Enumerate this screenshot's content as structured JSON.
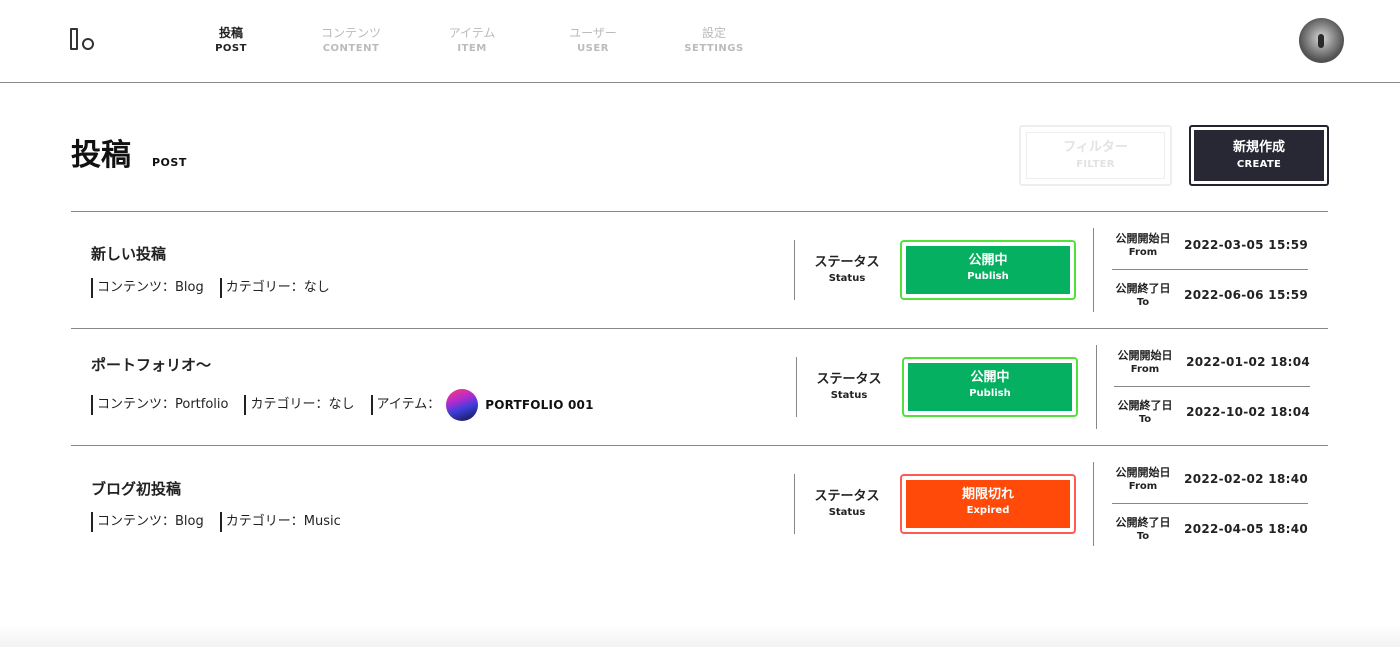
{
  "nav": [
    {
      "jp": "投稿",
      "en": "POST",
      "active": true
    },
    {
      "jp": "コンテンツ",
      "en": "CONTENT",
      "active": false
    },
    {
      "jp": "アイテム",
      "en": "ITEM",
      "active": false
    },
    {
      "jp": "ユーザー",
      "en": "USER",
      "active": false
    },
    {
      "jp": "設定",
      "en": "SETTINGS",
      "active": false
    }
  ],
  "page": {
    "title": "投稿",
    "subtitle": "POST"
  },
  "buttons": {
    "filter": {
      "jp": "フィルター",
      "en": "FILTER"
    },
    "create": {
      "jp": "新規作成",
      "en": "CREATE"
    }
  },
  "status_label": {
    "jp": "ステータス",
    "en": "Status"
  },
  "date_labels": {
    "from": {
      "jp": "公開開始日",
      "en": "From"
    },
    "to": {
      "jp": "公開終了日",
      "en": "To"
    }
  },
  "posts": [
    {
      "title": "新しい投稿",
      "content": "コンテンツ：Blog",
      "category": "カテゴリー：なし",
      "item": null,
      "status": {
        "jp": "公開中",
        "en": "Publish",
        "type": "publish",
        "color": "#06b061"
      },
      "from": "2022-03-05 15:59",
      "to": "2022-06-06 15:59"
    },
    {
      "title": "ポートフォリオ〜",
      "content": "コンテンツ：Portfolio",
      "category": "カテゴリー：なし",
      "item": {
        "label": "アイテム：",
        "name": "PORTFOLIO 001"
      },
      "status": {
        "jp": "公開中",
        "en": "Publish",
        "type": "publish",
        "color": "#06b061"
      },
      "from": "2022-01-02 18:04",
      "to": "2022-10-02 18:04"
    },
    {
      "title": "ブログ初投稿",
      "content": "コンテンツ：Blog",
      "category": "カテゴリー：Music",
      "item": null,
      "status": {
        "jp": "期限切れ",
        "en": "Expired",
        "type": "expired",
        "color": "#ff4a0a"
      },
      "from": "2022-02-02 18:40",
      "to": "2022-04-05 18:40"
    }
  ]
}
